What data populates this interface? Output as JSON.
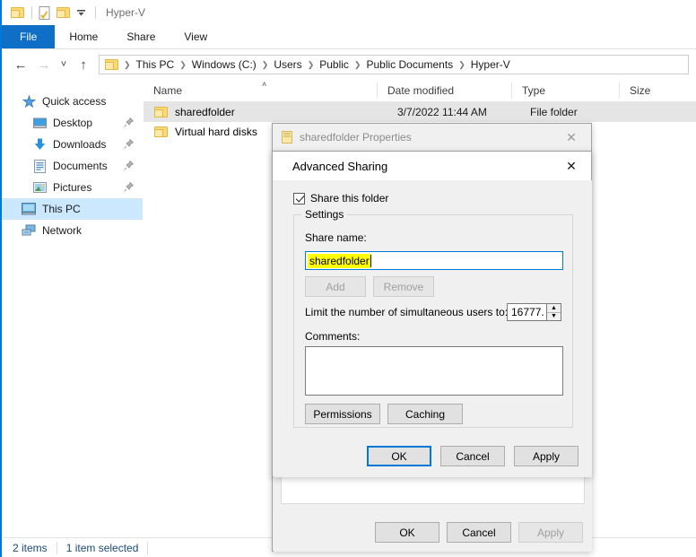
{
  "window": {
    "title": "Hyper-V",
    "quick_access": [
      "folder-icon",
      "properties-icon",
      "new-folder-icon",
      "dropdown-icon"
    ],
    "tabs": [
      {
        "label": "File",
        "active": true
      },
      {
        "label": "Home",
        "active": false
      },
      {
        "label": "Share",
        "active": false
      },
      {
        "label": "View",
        "active": false
      }
    ],
    "nav": {
      "back": "←",
      "forward": "→",
      "recent": "˅",
      "up": "↑"
    },
    "breadcrumbs": [
      "This PC",
      "Windows (C:)",
      "Users",
      "Public",
      "Public Documents",
      "Hyper-V"
    ],
    "breadcrumb_separator": "❯"
  },
  "sidebar": {
    "items": [
      {
        "label": "Quick access",
        "icon": "star-icon",
        "indent": false,
        "pinned": false,
        "selected": false
      },
      {
        "label": "Desktop",
        "icon": "desktop-icon",
        "indent": true,
        "pinned": true,
        "selected": false
      },
      {
        "label": "Downloads",
        "icon": "download-icon",
        "indent": true,
        "pinned": true,
        "selected": false
      },
      {
        "label": "Documents",
        "icon": "documents-icon",
        "indent": true,
        "pinned": true,
        "selected": false
      },
      {
        "label": "Pictures",
        "icon": "pictures-icon",
        "indent": true,
        "pinned": true,
        "selected": false
      },
      {
        "label": "This PC",
        "icon": "this-pc-icon",
        "indent": false,
        "pinned": false,
        "selected": true
      },
      {
        "label": "Network",
        "icon": "network-icon",
        "indent": false,
        "pinned": false,
        "selected": false
      }
    ],
    "pin_glyph": "📌"
  },
  "filelist": {
    "columns": [
      "Name",
      "Date modified",
      "Type",
      "Size"
    ],
    "sort_caret": "˄",
    "rows": [
      {
        "name": "sharedfolder",
        "date": "3/7/2022 11:44 AM",
        "type": "File folder",
        "size": "",
        "selected": true
      },
      {
        "name": "Virtual hard disks",
        "date": "",
        "type": "",
        "size": "",
        "selected": false
      }
    ]
  },
  "statusbar": {
    "items_count": "2 items",
    "selection": "1 item selected"
  },
  "properties_dialog": {
    "title": "sharedfolder Properties",
    "icon": "folder-properties-icon",
    "close": "✕",
    "buttons": [
      {
        "label": "OK",
        "disabled": false,
        "default": false
      },
      {
        "label": "Cancel",
        "disabled": false,
        "default": false
      },
      {
        "label": "Apply",
        "disabled": true,
        "default": false
      }
    ]
  },
  "advanced_sharing": {
    "title": "Advanced Sharing",
    "close": "✕",
    "share_checkbox": {
      "label": "Share this folder",
      "checked": true
    },
    "settings_group": "Settings",
    "share_name_label": "Share name:",
    "share_name_value": "sharedfolder",
    "add_button": "Add",
    "remove_button": "Remove",
    "limit_label": "Limit the number of simultaneous users to:",
    "limit_value": "16777.",
    "spin_up": "▲",
    "spin_down": "▼",
    "comments_label": "Comments:",
    "comments_value": "",
    "permissions_button": "Permissions",
    "caching_button": "Caching",
    "buttons": [
      {
        "label": "OK",
        "disabled": false,
        "default": true
      },
      {
        "label": "Cancel",
        "disabled": false,
        "default": false
      },
      {
        "label": "Apply",
        "disabled": false,
        "default": false
      }
    ]
  },
  "colors": {
    "accent": "#0078d7",
    "file_tab": "#0f6fc6",
    "selection_yellow": "#ffff00",
    "folder_yellow": "#fcd975"
  }
}
